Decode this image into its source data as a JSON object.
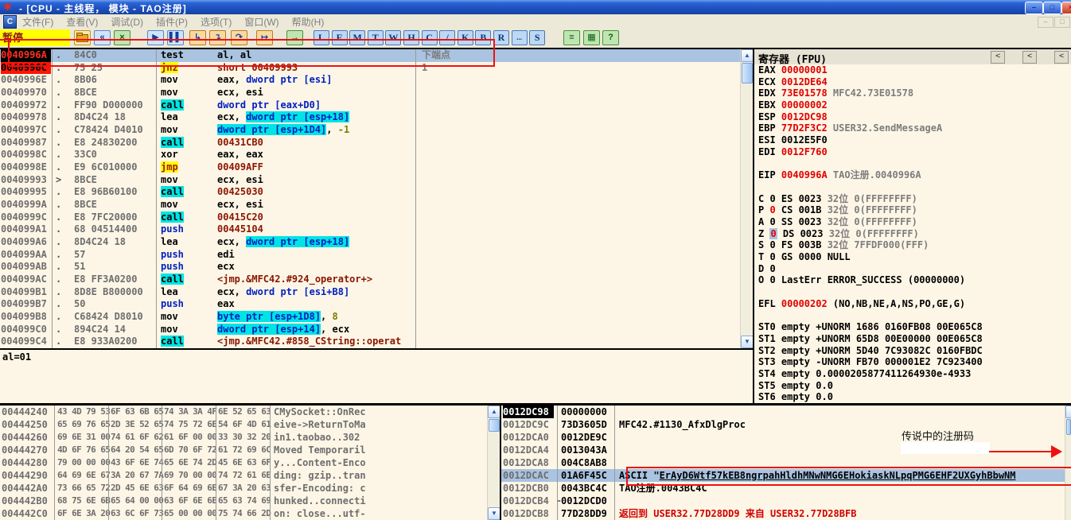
{
  "window": {
    "title": "-  [CPU -  主线程， 模块 - TAO注册]",
    "controls": [
      {
        "name": "minimize-button",
        "glyph": "–",
        "tint": "b"
      },
      {
        "name": "restore-button",
        "glyph": "□",
        "tint": "b"
      },
      {
        "name": "close-button",
        "glyph": "×",
        "tint": "r"
      }
    ]
  },
  "menu": {
    "items": [
      "文件(F)",
      "查看(V)",
      "调试(D)",
      "插件(P)",
      "选项(T)",
      "窗口(W)",
      "帮助(H)"
    ],
    "mdi_controls": [
      {
        "name": "mdi-minimize-button",
        "glyph": "–"
      },
      {
        "name": "mdi-restore-button",
        "glyph": "□"
      }
    ]
  },
  "toolbar": {
    "status_label": "暂停",
    "buttons": [
      {
        "name": "open-file-button",
        "glyph": "folder",
        "tint": "yellow"
      },
      {
        "name": "restart-button",
        "glyph": "«",
        "tint": "blue"
      },
      {
        "name": "close-program-button",
        "glyph": "×",
        "tint": "green"
      },
      {
        "name": "run-button",
        "glyph": "▶",
        "tint": "blue"
      },
      {
        "name": "pause-button",
        "glyph": "▌▌",
        "tint": "blue"
      },
      {
        "name": "step-into-button",
        "glyph": "↳",
        "tint": "orange"
      },
      {
        "name": "step-over-button",
        "glyph": "↴",
        "tint": "orange"
      },
      {
        "name": "animate-over-button",
        "glyph": "↷",
        "tint": "orange"
      },
      {
        "name": "execute-till-return-button",
        "glyph": "↦",
        "tint": "orange"
      },
      {
        "name": "go-to-address-button",
        "glyph": "→",
        "tint": "green"
      }
    ],
    "letter_buttons": [
      "L",
      "E",
      "M",
      "T",
      "W",
      "H",
      "C",
      "/",
      "K",
      "B",
      "R",
      "...",
      "S"
    ],
    "right_buttons": [
      {
        "name": "log-window-button",
        "glyph": "≡"
      },
      {
        "name": "appearance-button",
        "glyph": "▦"
      },
      {
        "name": "help-button",
        "glyph": "?"
      }
    ]
  },
  "disasm": {
    "rows": [
      {
        "a": "0040996A",
        "as": "bpe",
        "m": ".",
        "h": "84C0",
        "mn": "test",
        "ms": "",
        "sel": true,
        "ops": [
          {
            "t": "al, al",
            "c": "k"
          }
        ],
        "cmt": [
          {
            "t": "下端点",
            "c": "g"
          }
        ]
      },
      {
        "a": "0040996C",
        "as": "bp",
        "m": ".",
        "h": "75 25",
        "mn": "jnz",
        "ms": "jmp",
        "ops": [
          {
            "t": "short 00409993",
            "c": "dr"
          }
        ],
        "cmt": [
          {
            "t": "1",
            "c": "g"
          }
        ]
      },
      {
        "a": "0040996E",
        "m": ".",
        "h": "8B06",
        "mn": "mov",
        "ops": [
          {
            "t": "eax, ",
            "c": "k"
          },
          {
            "t": "dword ptr [esi]",
            "c": "b"
          }
        ]
      },
      {
        "a": "00409970",
        "m": ".",
        "h": "8BCE",
        "mn": "mov",
        "ops": [
          {
            "t": "ecx, esi",
            "c": "k"
          }
        ]
      },
      {
        "a": "00409972",
        "m": ".",
        "h": "FF90 D000000",
        "mn": "call",
        "ms": "call",
        "ops": [
          {
            "t": "dword ptr [eax+D0]",
            "c": "b"
          }
        ]
      },
      {
        "a": "00409978",
        "m": ".",
        "h": "8D4C24 18",
        "mn": "lea",
        "ops": [
          {
            "t": "ecx, ",
            "c": "k"
          },
          {
            "t": "dword ptr [esp+18]",
            "c": "cyb"
          }
        ]
      },
      {
        "a": "0040997C",
        "m": ".",
        "h": "C78424 D4010",
        "mn": "mov",
        "ops": [
          {
            "t": "dword ptr [esp+1D4]",
            "c": "cyb"
          },
          {
            "t": ", ",
            "c": "k"
          },
          {
            "t": "-1",
            "c": "ol"
          }
        ]
      },
      {
        "a": "00409987",
        "m": ".",
        "h": "E8 24830200",
        "mn": "call",
        "ms": "call",
        "ops": [
          {
            "t": "00431CB0",
            "c": "dr"
          }
        ]
      },
      {
        "a": "0040998C",
        "m": ".",
        "h": "33C0",
        "mn": "xor",
        "ops": [
          {
            "t": "eax, eax",
            "c": "k"
          }
        ]
      },
      {
        "a": "0040998E",
        "m": ".",
        "h": "E9 6C010000",
        "mn": "jmp",
        "ms": "jmp",
        "ops": [
          {
            "t": "00409AFF",
            "c": "dr"
          }
        ]
      },
      {
        "a": "00409993",
        "m": ">",
        "h": "8BCE",
        "mn": "mov",
        "ops": [
          {
            "t": "ecx, esi",
            "c": "k"
          }
        ]
      },
      {
        "a": "00409995",
        "m": ".",
        "h": "E8 96B60100",
        "mn": "call",
        "ms": "call",
        "ops": [
          {
            "t": "00425030",
            "c": "dr"
          }
        ]
      },
      {
        "a": "0040999A",
        "m": ".",
        "h": "8BCE",
        "mn": "mov",
        "ops": [
          {
            "t": "ecx, esi",
            "c": "k"
          }
        ]
      },
      {
        "a": "0040999C",
        "m": ".",
        "h": "E8 7FC20000",
        "mn": "call",
        "ms": "call",
        "ops": [
          {
            "t": "00415C20",
            "c": "dr"
          }
        ]
      },
      {
        "a": "004099A1",
        "m": ".",
        "h": "68 04514400",
        "mn": "push",
        "ms": "push",
        "ops": [
          {
            "t": "00445104",
            "c": "dr"
          }
        ]
      },
      {
        "a": "004099A6",
        "m": ".",
        "h": "8D4C24 18",
        "mn": "lea",
        "ops": [
          {
            "t": "ecx, ",
            "c": "k"
          },
          {
            "t": "dword ptr [esp+18]",
            "c": "cyb"
          }
        ]
      },
      {
        "a": "004099AA",
        "m": ".",
        "h": "57",
        "mn": "push",
        "ms": "push",
        "ops": [
          {
            "t": "edi",
            "c": "k"
          }
        ]
      },
      {
        "a": "004099AB",
        "m": ".",
        "h": "51",
        "mn": "push",
        "ms": "push",
        "ops": [
          {
            "t": "ecx",
            "c": "k"
          }
        ]
      },
      {
        "a": "004099AC",
        "m": ".",
        "h": "E8 FF3A0200",
        "mn": "call",
        "ms": "call",
        "ops": [
          {
            "t": "<jmp.&MFC42.#924_operator+>",
            "c": "dr"
          }
        ]
      },
      {
        "a": "004099B1",
        "m": ".",
        "h": "8D8E B800000",
        "mn": "lea",
        "ops": [
          {
            "t": "ecx, ",
            "c": "k"
          },
          {
            "t": "dword ptr [esi+B8]",
            "c": "b"
          }
        ]
      },
      {
        "a": "004099B7",
        "m": ".",
        "h": "50",
        "mn": "push",
        "ms": "push",
        "ops": [
          {
            "t": "eax",
            "c": "k"
          }
        ]
      },
      {
        "a": "004099B8",
        "m": ".",
        "h": "C68424 D8010",
        "mn": "mov",
        "ops": [
          {
            "t": "byte ptr [esp+1D8]",
            "c": "cyb"
          },
          {
            "t": ", ",
            "c": "k"
          },
          {
            "t": "8",
            "c": "ol"
          }
        ]
      },
      {
        "a": "004099C0",
        "m": ".",
        "h": "894C24 14",
        "mn": "mov",
        "ops": [
          {
            "t": "dword ptr [esp+14]",
            "c": "cyb"
          },
          {
            "t": ", ecx",
            "c": "k"
          }
        ]
      },
      {
        "a": "004099C4",
        "m": ".",
        "h": "E8 933A0200",
        "mn": "call",
        "ms": "call",
        "ops": [
          {
            "t": "<jmp.&MFC42.#858_CString::operat",
            "c": "dr"
          }
        ]
      }
    ]
  },
  "info_pane": {
    "text": "al=01"
  },
  "registers": {
    "title": "寄存器 (FPU)",
    "collapse_buttons": [
      "<",
      "<",
      "<"
    ],
    "lines": [
      [
        {
          "t": "EAX "
        },
        {
          "t": "00000001",
          "c": "r"
        }
      ],
      [
        {
          "t": "ECX "
        },
        {
          "t": "0012DE64",
          "c": "r"
        }
      ],
      [
        {
          "t": "EDX "
        },
        {
          "t": "73E01578",
          "c": "r"
        },
        {
          "t": " MFC42.73E01578",
          "c": "g"
        }
      ],
      [
        {
          "t": "EBX "
        },
        {
          "t": "00000002",
          "c": "r"
        }
      ],
      [
        {
          "t": "ESP "
        },
        {
          "t": "0012DC98",
          "c": "r"
        }
      ],
      [
        {
          "t": "EBP "
        },
        {
          "t": "77D2F3C2",
          "c": "r"
        },
        {
          "t": " USER32.SendMessageA",
          "c": "g"
        }
      ],
      [
        {
          "t": "ESI 0012E5F0"
        }
      ],
      [
        {
          "t": "EDI "
        },
        {
          "t": "0012F760",
          "c": "r"
        }
      ],
      [],
      [
        {
          "t": "EIP "
        },
        {
          "t": "0040996A",
          "c": "r"
        },
        {
          "t": " TAO注册.0040996A",
          "c": "g"
        }
      ],
      [],
      [
        {
          "t": "C 0  ES 0023 "
        },
        {
          "t": "32位 0(FFFFFFFF)",
          "c": "g"
        }
      ],
      [
        {
          "t": "P "
        },
        {
          "t": "0",
          "c": "r"
        },
        {
          "t": "  CS 001B "
        },
        {
          "t": "32位 0(FFFFFFFF)",
          "c": "g"
        }
      ],
      [
        {
          "t": "A 0  SS 0023 "
        },
        {
          "t": "32位 0(FFFFFFFF)",
          "c": "g"
        }
      ],
      [
        {
          "t": "Z "
        },
        {
          "t": "0",
          "c": "zf"
        },
        {
          "t": "  DS 0023 "
        },
        {
          "t": "32位 0(FFFFFFFF)",
          "c": "g"
        }
      ],
      [
        {
          "t": "S 0  FS 003B "
        },
        {
          "t": "32位 7FFDF000(FFF)",
          "c": "g"
        }
      ],
      [
        {
          "t": "T 0  GS 0000 NULL"
        }
      ],
      [
        {
          "t": "D 0"
        }
      ],
      [
        {
          "t": "O 0  LastErr ERROR_SUCCESS (00000000)"
        }
      ],
      [],
      [
        {
          "t": "EFL "
        },
        {
          "t": "00000202",
          "c": "r"
        },
        {
          "t": " (NO,NB,NE,A,NS,PO,GE,G)"
        }
      ],
      [],
      [
        {
          "t": "ST0 empty +UNORM 1686 0160FB08 00E065C8"
        }
      ],
      [
        {
          "t": "ST1 empty +UNORM 65D8 00E00000 00E065C8"
        }
      ],
      [
        {
          "t": "ST2 empty +UNORM 5D40 7C93082C 0160FBDC"
        }
      ],
      [
        {
          "t": "ST3 empty -UNORM FB70 000001E2 7C923400"
        }
      ],
      [
        {
          "t": "ST4 empty 0.0000205877411264930e-4933"
        }
      ],
      [
        {
          "t": "ST5 empty 0.0"
        }
      ],
      [
        {
          "t": "ST6 empty 0.0"
        }
      ]
    ]
  },
  "dump": {
    "rows": [
      {
        "addr": "00444240",
        "b": [
          "43 4D 79 53",
          "6F 63 6B 65",
          "74 3A 3A 4F",
          "6E 52 65 63"
        ],
        "ascii": "CMySocket::OnRec"
      },
      {
        "addr": "00444250",
        "b": [
          "65 69 76 65",
          "2D 3E 52 65",
          "74 75 72 6E",
          "54 6F 4D 61"
        ],
        "ascii": "eive->ReturnToMa"
      },
      {
        "addr": "00444260",
        "b": [
          "69 6E 31 00",
          "74 61 6F 62",
          "61 6F 00 00",
          "33 30 32 20"
        ],
        "ascii": "in1.taobao..302 "
      },
      {
        "addr": "00444270",
        "b": [
          "4D 6F 76 65",
          "64 20 54 65",
          "6D 70 6F 72",
          "61 72 69 6C"
        ],
        "ascii": "Moved Temporaril"
      },
      {
        "addr": "00444280",
        "b": [
          "79 00 00 00",
          "43 6F 6E 74",
          "65 6E 74 2D",
          "45 6E 63 6F"
        ],
        "ascii": "y...Content-Enco"
      },
      {
        "addr": "00444290",
        "b": [
          "64 69 6E 67",
          "3A 20 67 7A",
          "69 70 00 00",
          "74 72 61 6E"
        ],
        "ascii": "ding: gzip..tran"
      },
      {
        "addr": "004442A0",
        "b": [
          "73 66 65 72",
          "2D 45 6E 63",
          "6F 64 69 6E",
          "67 3A 20 63"
        ],
        "ascii": "sfer-Encoding: c"
      },
      {
        "addr": "004442B0",
        "b": [
          "68 75 6E 6B",
          "65 64 00 00",
          "63 6F 6E 6E",
          "65 63 74 69"
        ],
        "ascii": "hunked..connecti"
      },
      {
        "addr": "004442C0",
        "b": [
          "6F 6E 3A 20",
          "63 6C 6F 73",
          "65 00 00 00",
          "75 74 66 2D"
        ],
        "ascii": "on: close...utf-"
      }
    ]
  },
  "stack": {
    "rows": [
      {
        "a": "0012DC98",
        "as": "active",
        "v": "00000000"
      },
      {
        "a": "0012DC9C",
        "v": "73D3605D",
        "cmt": [
          {
            "t": "MFC42.#1130_AfxDlgProc"
          }
        ]
      },
      {
        "a": "0012DCA0",
        "v": "0012DE9C"
      },
      {
        "a": "0012DCA4",
        "v": "0013043A"
      },
      {
        "a": "0012DCA8",
        "v": "004C8AB8"
      },
      {
        "a": "0012DCAC",
        "v": "01A6F45C",
        "sel": true,
        "cmt": [
          {
            "t": "ASCII \""
          },
          {
            "t": "ErAyD6Wtf57kEB8ngrpahHldhMNwNMG6EHokiaskNLpqPMG6EHF2UXGyhBbwNM",
            "c": "u"
          }
        ]
      },
      {
        "a": "0012DCB0",
        "v": "0043BC4C",
        "cmt": [
          {
            "t": "TAO注册.0043BC4C"
          }
        ]
      },
      {
        "a": "0012DCB4",
        "v": "0012DCD0",
        "br": "┌"
      },
      {
        "a": "0012DCB8",
        "v": "77D28DD9",
        "br": "│",
        "cmt": [
          {
            "t": "返回到 USER32.77D28DD9 来自 USER32.77D28BFB",
            "c": "rr"
          }
        ]
      }
    ]
  },
  "annotations": {
    "registration_label": "传说中的注册码"
  },
  "colors": {
    "annotation_red": "#ee1111",
    "selection_blue": "#a9c3e0",
    "breakpoint_red": "#ff1400",
    "call_highlight": "#00e4e4",
    "jump_highlight": "#ffff00",
    "pane_background": "#fdf6e6",
    "pause_yellow": "#ffff00"
  }
}
